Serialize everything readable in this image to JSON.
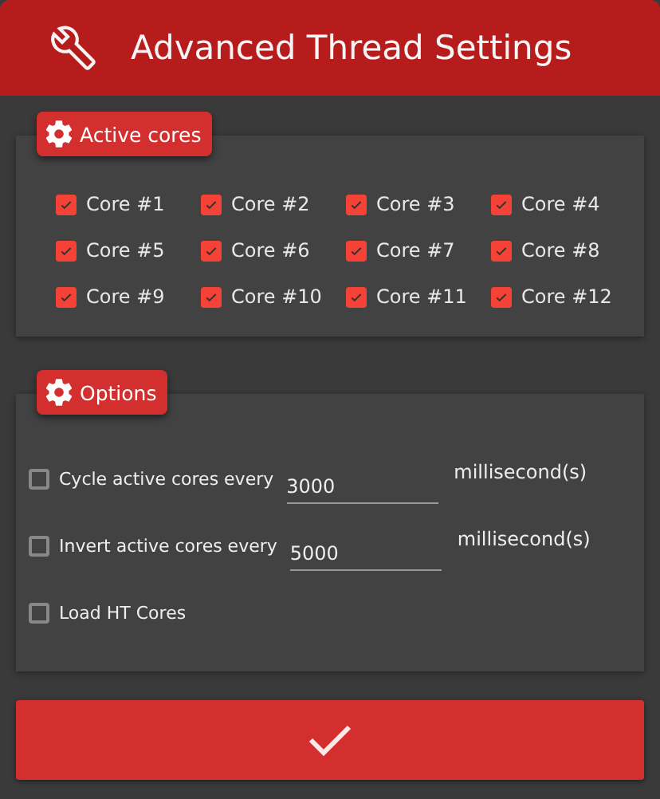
{
  "window": {
    "title": "Advanced Thread Settings"
  },
  "active_cores": {
    "title": "Active cores",
    "cores": [
      {
        "label": "Core #1",
        "checked": true
      },
      {
        "label": "Core #2",
        "checked": true
      },
      {
        "label": "Core #3",
        "checked": true
      },
      {
        "label": "Core #4",
        "checked": true
      },
      {
        "label": "Core #5",
        "checked": true
      },
      {
        "label": "Core #6",
        "checked": true
      },
      {
        "label": "Core #7",
        "checked": true
      },
      {
        "label": "Core #8",
        "checked": true
      },
      {
        "label": "Core #9",
        "checked": true
      },
      {
        "label": "Core #10",
        "checked": true
      },
      {
        "label": "Core #11",
        "checked": true
      },
      {
        "label": "Core #12",
        "checked": true
      }
    ]
  },
  "options": {
    "title": "Options",
    "items": [
      {
        "kind": "interval",
        "label": "Cycle active cores every",
        "checked": false,
        "value": "3000",
        "unit": "millisecond(s)"
      },
      {
        "kind": "interval",
        "label": "Invert active cores every",
        "checked": false,
        "value": "5000",
        "unit": "millisecond(s)"
      },
      {
        "kind": "plain",
        "label": "Load HT Cores",
        "checked": false
      }
    ]
  }
}
